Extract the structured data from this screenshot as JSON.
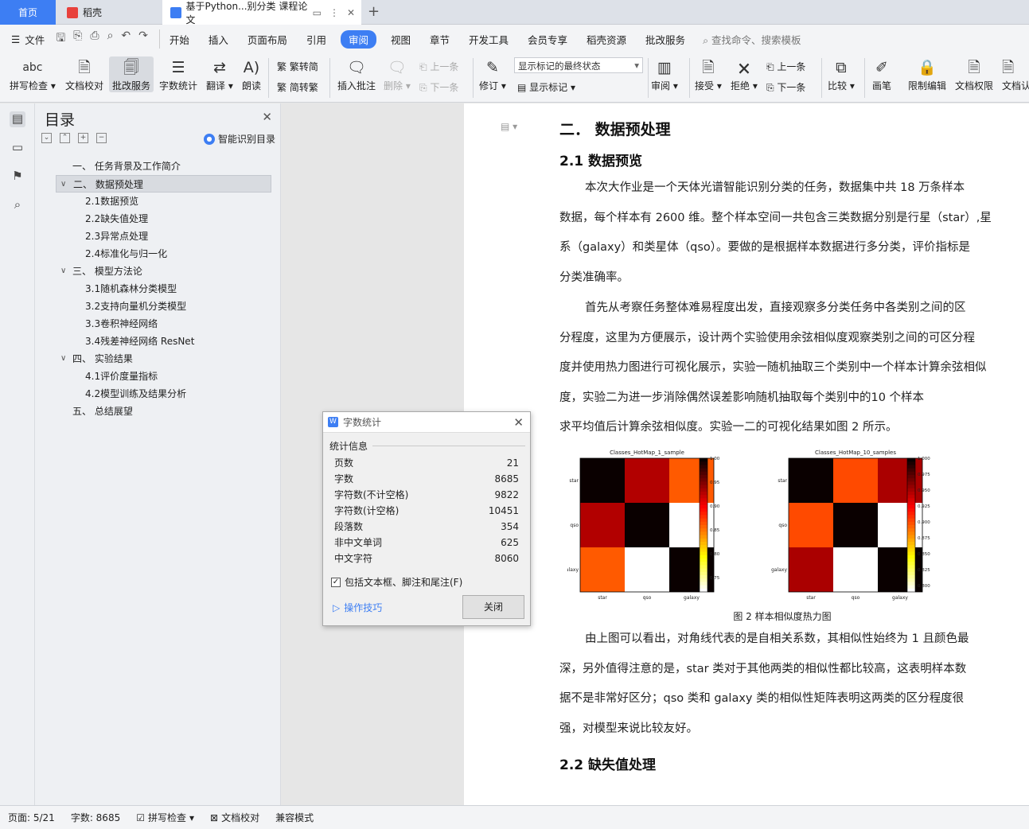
{
  "tabs": {
    "home": "首页",
    "daoke": "稻壳",
    "doc": "基于Python...别分类 课程论文"
  },
  "menu": {
    "file": "文件",
    "items": [
      "开始",
      "插入",
      "页面布局",
      "引用",
      "审阅",
      "视图",
      "章节",
      "开发工具",
      "会员专享",
      "稻壳资源",
      "批改服务"
    ],
    "search": "查找命令、搜索模板"
  },
  "ribbon": {
    "spell": "拼写检查",
    "proof": "文档校对",
    "review_service": "批改服务",
    "wordcount": "字数统计",
    "translate": "翻译",
    "read": "朗读",
    "trad2simp": "繁转简",
    "simp2trad": "简转繁",
    "insert_comment": "插入批注",
    "delete": "删除",
    "prev": "上一条",
    "next": "下一条",
    "revise": "修订",
    "status_dropdown": "显示标记的最终状态",
    "show_marks": "显示标记",
    "review": "审阅",
    "accept": "接受",
    "reject": "拒绝",
    "prev2": "上一条",
    "next2": "下一条",
    "compare": "比较",
    "pen": "画笔",
    "restrict": "限制编辑",
    "perm": "文档权限",
    "docauth": "文档认"
  },
  "toc": {
    "title": "目录",
    "smart": "智能识别目录",
    "items": [
      {
        "label": "一、  任务背景及工作简介"
      },
      {
        "label": "二、  数据预处理"
      },
      {
        "label": "2.1数据预览"
      },
      {
        "label": "2.2缺失值处理"
      },
      {
        "label": "2.3异常点处理"
      },
      {
        "label": "2.4标准化与归一化"
      },
      {
        "label": "三、  模型方法论"
      },
      {
        "label": "3.1随机森林分类模型"
      },
      {
        "label": "3.2支持向量机分类模型"
      },
      {
        "label": "3.3卷积神经网络"
      },
      {
        "label": "3.4残差神经网络 ResNet"
      },
      {
        "label": "四、  实验结果"
      },
      {
        "label": "4.1评价度量指标"
      },
      {
        "label": "4.2模型训练及结果分析"
      },
      {
        "label": "五、  总结展望"
      }
    ]
  },
  "doc": {
    "h1": "二．  数据预处理",
    "h2a": "2.1  数据预览",
    "p1": [
      "本次大作业是一个天体光谱智能识别分类的任务，数据集中共 18 万条样本",
      "数据，每个样本有 2600 维。整个样本空间一共包含三类数据分别是行星（star）,星",
      "系（galaxy）和类星体（qso）。要做的是根据样本数据进行多分类，评价指标是",
      "分类准确率。"
    ],
    "p2": [
      "首先从考察任务整体难易程度出发，直接观察多分类任务中各类别之间的区",
      "分程度，这里为方便展示，设计两个实验使用余弦相似度观察类别之间的可区分程",
      "度并使用热力图进行可视化展示，实验一随机抽取三个类别中一个样本计算余弦相似",
      "度，实验二为进一步消除偶然误差影响随机抽取每个类别中的10 个样本",
      "求平均值后计算余弦相似度。实验一二的可视化结果如图 2 所示。"
    ],
    "caption": "图  2 样本相似度热力图",
    "p3": [
      "由上图可以看出，对角线代表的是自相关系数，其相似性始终为 1 且颜色最",
      "深，另外值得注意的是，star 类对于其他两类的相似性都比较高，这表明样本数",
      "据不是非常好区分；qso 类和  galaxy 类的相似性矩阵表明这两类的区分程度很",
      "强，对模型来说比较友好。"
    ],
    "h2b": "2.2  缺失值处理"
  },
  "chart_data": [
    {
      "type": "heatmap",
      "title": "Classes_HotMap_1_sample",
      "categories": [
        "star",
        "qso",
        "galaxy"
      ],
      "values": [
        [
          1.0,
          0.93,
          0.86
        ],
        [
          0.93,
          1.0,
          0.72
        ],
        [
          0.86,
          0.72,
          1.0
        ]
      ],
      "colorbar_ticks": [
        "1.00",
        "0.95",
        "0.90",
        "0.85",
        "0.80",
        "0.75"
      ],
      "colorbar_range": [
        0.72,
        1.0
      ]
    },
    {
      "type": "heatmap",
      "title": "Classes_HotMap_10_samples",
      "categories": [
        "star",
        "qso",
        "galaxy"
      ],
      "values": [
        [
          1.0,
          0.9,
          0.95
        ],
        [
          0.9,
          1.0,
          0.79
        ],
        [
          0.95,
          0.79,
          1.0
        ]
      ],
      "colorbar_ticks": [
        "1.000",
        "0.975",
        "0.950",
        "0.925",
        "0.900",
        "0.875",
        "0.850",
        "0.825",
        "0.800"
      ],
      "colorbar_range": [
        0.79,
        1.0
      ]
    }
  ],
  "dialog": {
    "title": "字数统计",
    "section": "统计信息",
    "rows": [
      {
        "label": "页数",
        "value": "21"
      },
      {
        "label": "字数",
        "value": "8685"
      },
      {
        "label": "字符数(不计空格)",
        "value": "9822"
      },
      {
        "label": "字符数(计空格)",
        "value": "10451"
      },
      {
        "label": "段落数",
        "value": "354"
      },
      {
        "label": "非中文单词",
        "value": "625"
      },
      {
        "label": "中文字符",
        "value": "8060"
      }
    ],
    "checkbox": "包括文本框、脚注和尾注(F)",
    "tips": "操作技巧",
    "close": "关闭"
  },
  "status": {
    "page": "页面: 5/21",
    "words": "字数: 8685",
    "spell": "拼写检查",
    "proof": "文档校对",
    "compat": "兼容模式"
  }
}
